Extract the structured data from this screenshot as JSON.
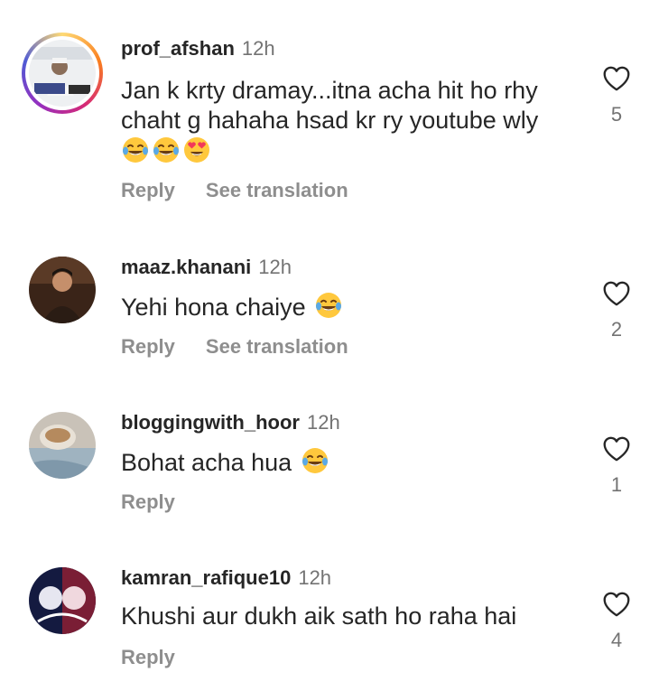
{
  "comments": [
    {
      "username": "prof_afshan",
      "time": "12h",
      "text_line1": "Jan k krty dramay...itna acha hit ho rhy",
      "text_line2": "chaht g hahaha hsad kr ry youtube wly",
      "emojis": [
        "joy-emoji",
        "joy-emoji",
        "heart-eyes-emoji"
      ],
      "reply_label": "Reply",
      "translate_label": "See translation",
      "likes": "5",
      "has_story_ring": true
    },
    {
      "username": "maaz.khanani",
      "time": "12h",
      "text": "Yehi hona chaiye",
      "emojis": [
        "joy-emoji"
      ],
      "reply_label": "Reply",
      "translate_label": "See translation",
      "likes": "2"
    },
    {
      "username": "bloggingwith_hoor",
      "time": "12h",
      "text": "Bohat acha hua",
      "emojis": [
        "joy-emoji"
      ],
      "reply_label": "Reply",
      "likes": "1"
    },
    {
      "username": "kamran_rafique10",
      "time": "12h",
      "text": "Khushi aur dukh aik sath ho raha hai",
      "reply_label": "Reply",
      "likes": "4"
    }
  ],
  "colors": {
    "text": "#262626",
    "secondary": "#737373",
    "action": "#8e8e8e",
    "emoji_face": "#ffc83d",
    "tear": "#5aa9e6",
    "heart": "#f2385a"
  }
}
